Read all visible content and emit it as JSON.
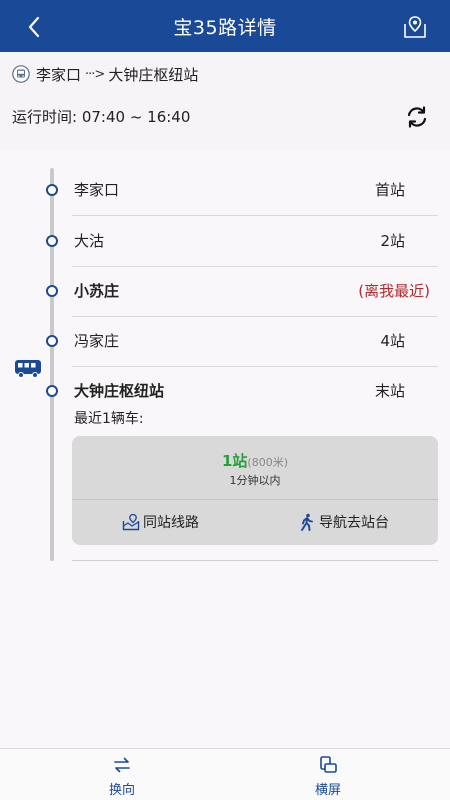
{
  "header": {
    "title": "宝35路详情",
    "back_icon": "chevron-left-icon",
    "map_icon": "map-pin-icon",
    "bg_color": "#1a4a97"
  },
  "route": {
    "from": "李家口",
    "arrow": "···>",
    "to": "大钟庄枢纽站"
  },
  "operating_time": "运行时间: 07:40 ~ 16:40",
  "stops": [
    {
      "name": "李家口",
      "tag": "首站"
    },
    {
      "name": "大沽",
      "tag": "2站"
    },
    {
      "name": "小苏庄",
      "tag": "(离我最近)"
    },
    {
      "name": "冯家庄",
      "tag": "4站"
    },
    {
      "name": "大钟庄枢纽站",
      "tag": "末站"
    }
  ],
  "recent_label": "最近1辆车:",
  "vehicle": {
    "stops_away": "1站",
    "distance": "(800米)",
    "eta": "1分钟以内"
  },
  "actions": {
    "same_station": "同站线路",
    "navigate": "导航去站台"
  },
  "tabs": {
    "reverse": "换向",
    "landscape": "横屏"
  },
  "colors": {
    "accent": "#1a4a97",
    "near_red": "#b22a30",
    "count_green": "#26a13a"
  }
}
